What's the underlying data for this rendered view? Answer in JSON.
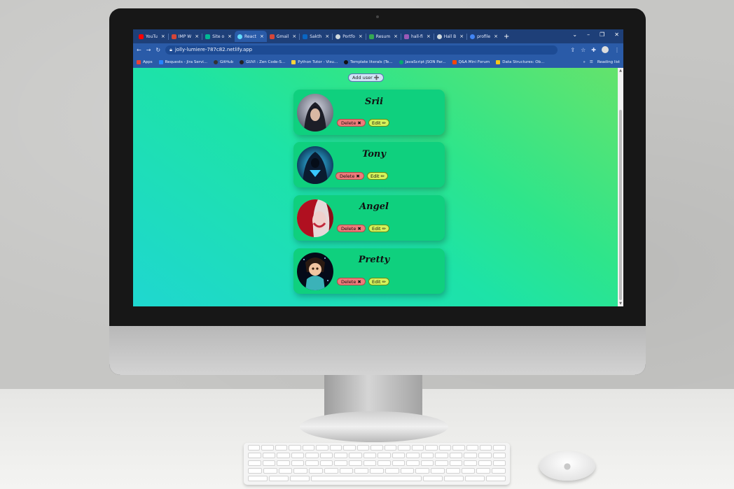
{
  "browser": {
    "tabs": [
      {
        "label": "YouTu",
        "color": "#ff0000"
      },
      {
        "label": "IMP W",
        "color": "#d44638"
      },
      {
        "label": "Site o",
        "color": "#00b894"
      },
      {
        "label": "React",
        "color": "#61dafb",
        "active": true
      },
      {
        "label": "Gmail",
        "color": "#d44638"
      },
      {
        "label": "Sakth",
        "color": "#0a66c2"
      },
      {
        "label": "Portfo",
        "color": "#cfd8dc"
      },
      {
        "label": "Resum",
        "color": "#34a853"
      },
      {
        "label": "hall-fi",
        "color": "#9b59b6"
      },
      {
        "label": "Hall B",
        "color": "#cfd8dc"
      },
      {
        "label": "profile",
        "color": "#4285f4"
      }
    ],
    "new_tab": "+",
    "window_controls": [
      "⌄",
      "–",
      "❐",
      "✕"
    ],
    "url": "jolly-lumiere-787c82.netlify.app",
    "bookmarks": [
      {
        "label": "Apps",
        "color": "#ea4335"
      },
      {
        "label": "Requests - Jira Servi...",
        "color": "#2684ff"
      },
      {
        "label": "GitHub",
        "color": "#333333"
      },
      {
        "label": "GUVI : Zen Code-S...",
        "color": "#222222"
      },
      {
        "label": "Python Tutor - Visu...",
        "color": "#ffd43b"
      },
      {
        "label": "Template literals (Te...",
        "color": "#111111"
      },
      {
        "label": "JavaScript JSON Par...",
        "color": "#04aa6d"
      },
      {
        "label": "Q&A Mini Forum",
        "color": "#ff4500"
      },
      {
        "label": "Data Structures: Ob...",
        "color": "#f5c518"
      }
    ],
    "bookmarks_more": "»",
    "reading_list": "Reading list"
  },
  "app": {
    "add_user_label": "Add user ➕",
    "delete_label": "Delete ✖",
    "edit_label": "Edit ✏",
    "users": [
      {
        "name": "Srii"
      },
      {
        "name": "Tony"
      },
      {
        "name": "Angel"
      },
      {
        "name": "Pretty"
      }
    ]
  }
}
